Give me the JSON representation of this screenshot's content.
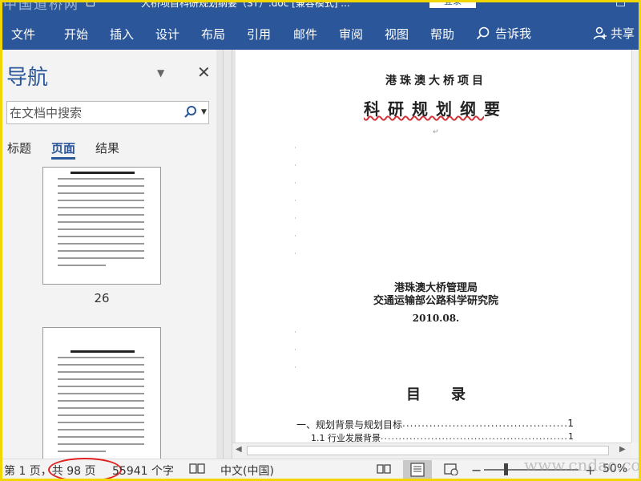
{
  "watermark_top": "中国道桥网",
  "watermark_bottom": "www.cndao.com",
  "window": {
    "title": "大桥项目科研规划纲要（ST）.doc [兼容模式] ...",
    "signin_label": "登录"
  },
  "ribbon": {
    "tabs": [
      "文件",
      "开始",
      "插入",
      "设计",
      "布局",
      "引用",
      "邮件",
      "审阅",
      "视图",
      "帮助"
    ],
    "tell_me": "告诉我",
    "share": "共享"
  },
  "nav_pane": {
    "title": "导航",
    "search_placeholder": "在文档中搜索",
    "tabs": [
      "标题",
      "页面",
      "结果"
    ],
    "active_tab": "页面",
    "thumbnail_pages": [
      "26"
    ]
  },
  "document": {
    "project": "港珠澳大桥项目",
    "title_main": "科研规划纲",
    "title_tail": "要",
    "org1": "港珠澳大桥管理局",
    "org2": "交通运输部公路科学研究院",
    "date": "2010.08.",
    "toc_heading": "目录",
    "toc": [
      {
        "label": "一、规划背景与规划目标",
        "page": "1"
      },
      {
        "label": "1.1 行业发展背景",
        "page": "1"
      }
    ]
  },
  "status_bar": {
    "page_info": "第 1 页，共 98 页",
    "word_count": "55941 个字",
    "language": "中文(中国)",
    "zoom": "50%"
  },
  "colors": {
    "ribbon": "#2b579a",
    "frame": "#f2d600",
    "highlight_circle": "#e02020"
  }
}
